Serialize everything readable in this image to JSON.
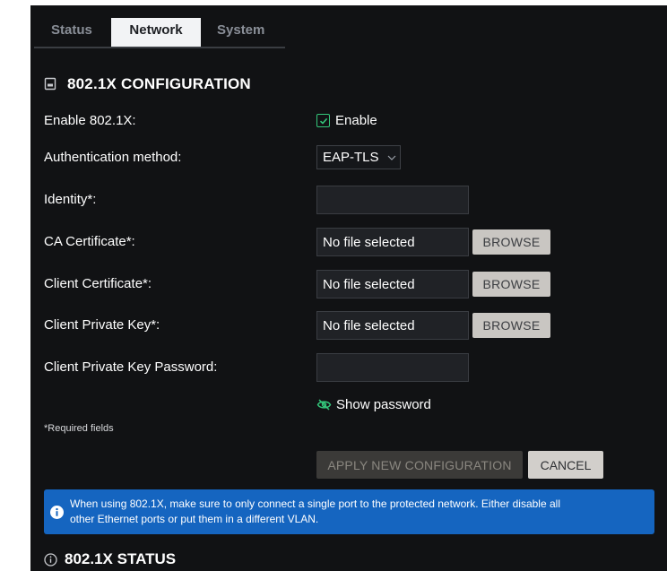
{
  "tabs": [
    {
      "label": "Status",
      "active": false
    },
    {
      "label": "Network",
      "active": true
    },
    {
      "label": "System",
      "active": false
    }
  ],
  "section": {
    "title": "802.1X CONFIGURATION",
    "icon": "document-icon"
  },
  "form": {
    "enable": {
      "label": "Enable 802.1X:",
      "checkbox_label": "Enable",
      "checked": true
    },
    "auth_method": {
      "label": "Authentication method:",
      "value": "EAP-TLS"
    },
    "identity": {
      "label": "Identity*:",
      "value": ""
    },
    "ca_cert": {
      "label": "CA Certificate*:",
      "value": "No file selected",
      "button": "BROWSE"
    },
    "client_cert": {
      "label": "Client Certificate*:",
      "value": "No file selected",
      "button": "BROWSE"
    },
    "client_key": {
      "label": "Client Private Key*:",
      "value": "No file selected",
      "button": "BROWSE"
    },
    "key_password": {
      "label": "Client Private Key Password:",
      "value": ""
    },
    "show_password": {
      "label": "Show password",
      "icon": "eye-off-icon"
    }
  },
  "required_note": "*Required fields",
  "buttons": {
    "apply": "APPLY NEW CONFIGURATION",
    "cancel": "CANCEL"
  },
  "alert": {
    "icon": "info-icon",
    "line1": "When using 802.1X, make sure to only connect a single port to the protected network. Either disable all",
    "line2": "other Ethernet ports or put them in a different VLAN."
  },
  "status_section": {
    "title": "802.1X STATUS",
    "icon": "info-circle-icon"
  },
  "colors": {
    "background": "#111214",
    "accent_green": "#34c77b",
    "alert_blue": "#1565c0",
    "button_light": "#c9c6c2"
  }
}
